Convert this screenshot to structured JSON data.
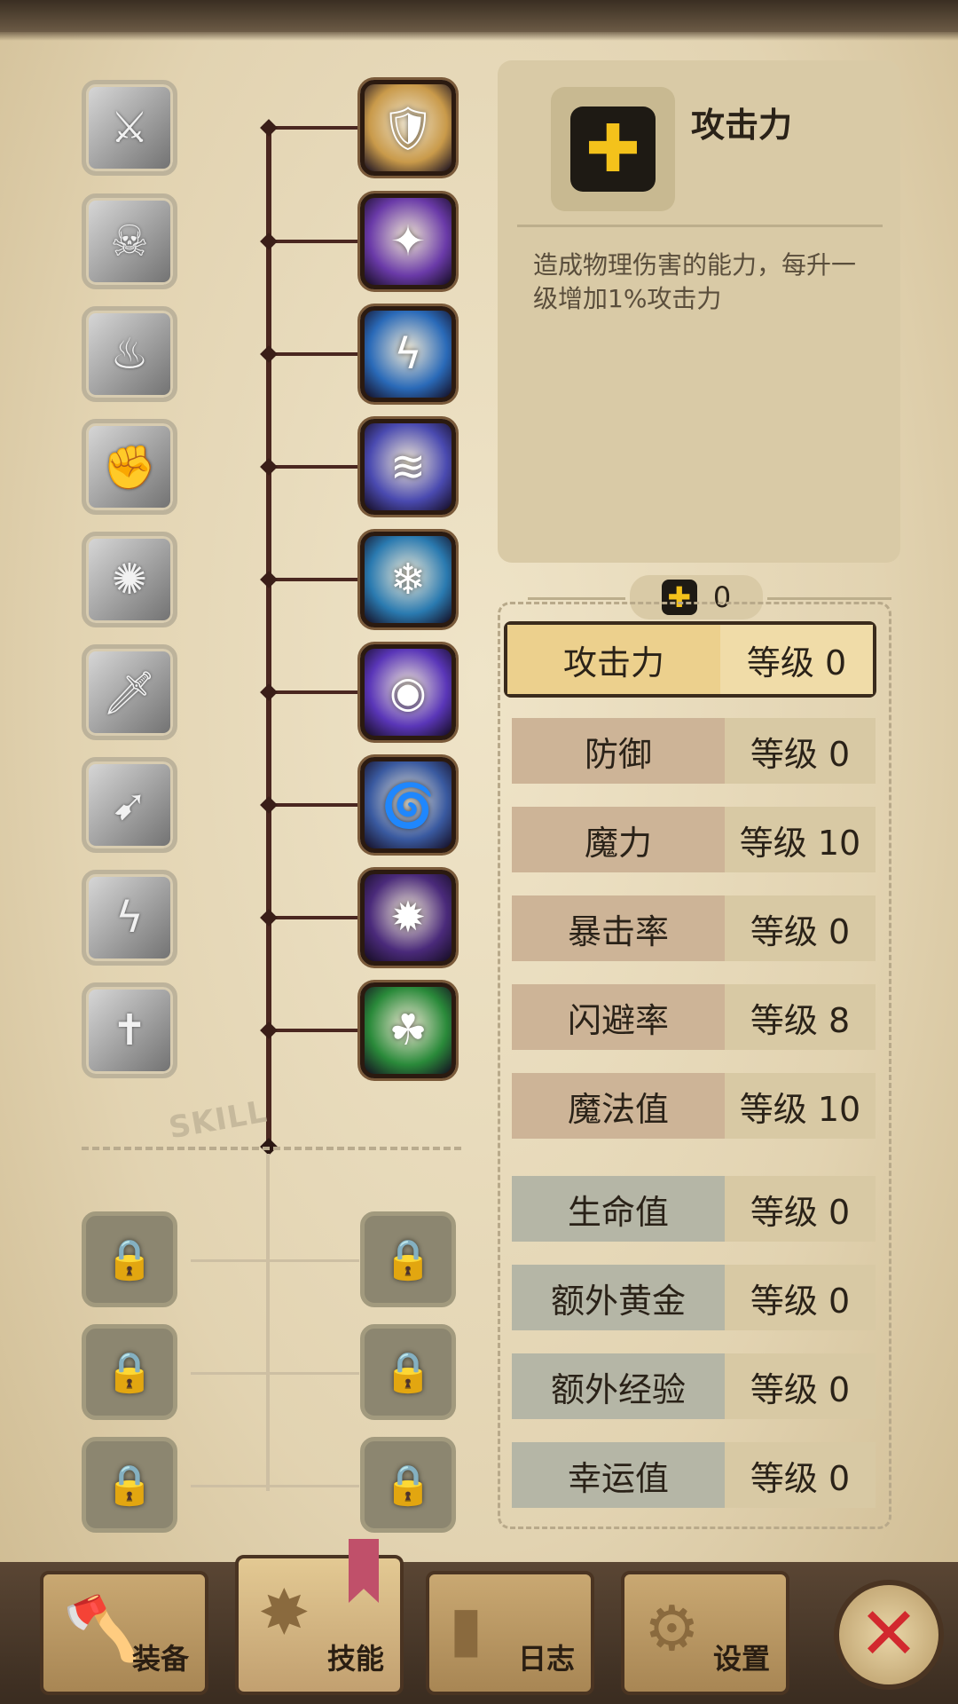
{
  "detail": {
    "title": "攻击力",
    "icon": "plus-icon",
    "plus_glyph": "✚",
    "description": "造成物理伤害的能力，每升一级增加1%攻击力"
  },
  "points": {
    "icon": "plus-icon",
    "plus_glyph": "✚",
    "value": "0"
  },
  "skill_tag": "SKILL",
  "stats": [
    {
      "label": "攻击力",
      "level": "等级 0",
      "style": "active"
    },
    {
      "label": "防御",
      "level": "等级 0",
      "style": "brown"
    },
    {
      "label": "魔力",
      "level": "等级 10",
      "style": "brown"
    },
    {
      "label": "暴击率",
      "level": "等级 0",
      "style": "brown"
    },
    {
      "label": "闪避率",
      "level": "等级 8",
      "style": "brown"
    },
    {
      "label": "魔法值",
      "level": "等级 10",
      "style": "brown"
    },
    {
      "label": "生命值",
      "level": "等级 0",
      "style": "blue"
    },
    {
      "label": "额外黄金",
      "level": "等级 0",
      "style": "blue"
    },
    {
      "label": "额外经验",
      "level": "等级 0",
      "style": "blue"
    },
    {
      "label": "幸运值",
      "level": "等级 0",
      "style": "blue"
    }
  ],
  "left_skills": [
    {
      "icon": "blade-slash-icon",
      "glyph": "⚔"
    },
    {
      "icon": "bone-kick-icon",
      "glyph": "☠"
    },
    {
      "icon": "fire-demon-icon",
      "glyph": "♨"
    },
    {
      "icon": "flex-arm-icon",
      "glyph": "✊"
    },
    {
      "icon": "spin-strike-icon",
      "glyph": "✺"
    },
    {
      "icon": "dagger-icon",
      "glyph": "🗡"
    },
    {
      "icon": "dash-strike-icon",
      "glyph": "➹"
    },
    {
      "icon": "lightning-storm-icon",
      "glyph": "ϟ"
    },
    {
      "icon": "sword-cross-icon",
      "glyph": "✝"
    }
  ],
  "right_skills": [
    {
      "icon": "shield-cross-icon",
      "glyph": "🛡",
      "color": "#c99a4a"
    },
    {
      "icon": "shadow-punch-icon",
      "glyph": "✦",
      "color": "#6a3aa8"
    },
    {
      "icon": "lightning-figure-icon",
      "glyph": "ϟ",
      "color": "#2a6ab8"
    },
    {
      "icon": "wind-rush-icon",
      "glyph": "≋",
      "color": "#4a4ab0"
    },
    {
      "icon": "ice-burst-icon",
      "glyph": "❄",
      "color": "#2a7ab0"
    },
    {
      "icon": "void-eye-icon",
      "glyph": "◉",
      "color": "#5a36b8"
    },
    {
      "icon": "tornado-blade-icon",
      "glyph": "🌀",
      "color": "#3a5aa0"
    },
    {
      "icon": "dark-orb-icon",
      "glyph": "✹",
      "color": "#4a2a7a"
    },
    {
      "icon": "clover-spirit-icon",
      "glyph": "☘",
      "color": "#2a8a3a"
    }
  ],
  "locked_skills": [
    {
      "icon": "lock-icon",
      "glyph": "🔒"
    },
    {
      "icon": "lock-icon",
      "glyph": "🔒"
    },
    {
      "icon": "lock-icon",
      "glyph": "🔒"
    },
    {
      "icon": "lock-icon",
      "glyph": "🔒"
    },
    {
      "icon": "lock-icon",
      "glyph": "🔒"
    },
    {
      "icon": "lock-icon",
      "glyph": "🔒"
    }
  ],
  "nav": {
    "tabs": [
      {
        "label": "装备",
        "icon": "axe-icon",
        "glyph": "🪓"
      },
      {
        "label": "技能",
        "icon": "burst-icon",
        "glyph": "✸"
      },
      {
        "label": "日志",
        "icon": "book-icon",
        "glyph": "▮"
      },
      {
        "label": "设置",
        "icon": "gear-icon",
        "glyph": "⚙"
      }
    ],
    "close_icon": "close-icon",
    "close_glyph": "✕"
  }
}
